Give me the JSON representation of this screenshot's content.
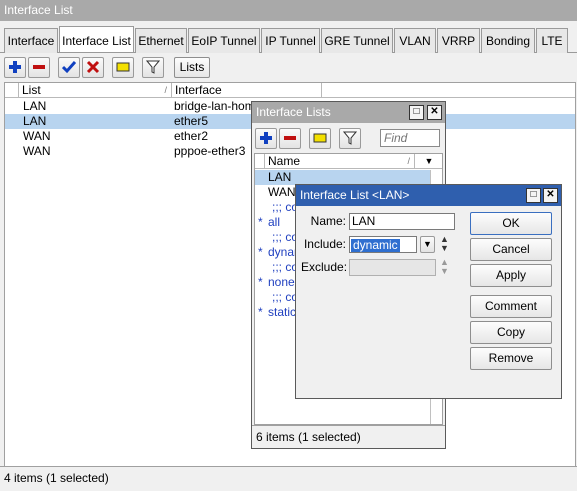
{
  "main": {
    "title": "Interface List",
    "tabs": [
      "Interface",
      "Interface List",
      "Ethernet",
      "EoIP Tunnel",
      "IP Tunnel",
      "GRE Tunnel",
      "VLAN",
      "VRRP",
      "Bonding",
      "LTE"
    ],
    "lists_button": "Lists",
    "columns": [
      "List",
      "Interface"
    ],
    "rows": [
      {
        "list": "LAN",
        "interface": "bridge-lan-home"
      },
      {
        "list": "LAN",
        "interface": "ether5"
      },
      {
        "list": "WAN",
        "interface": "ether2"
      },
      {
        "list": "WAN",
        "interface": "pppoe-ether3"
      }
    ],
    "status": "4 items (1 selected)"
  },
  "lists_window": {
    "title": "Interface Lists",
    "find_placeholder": "Find",
    "column": "Name",
    "rows": [
      {
        "flag": "",
        "name": "LAN"
      },
      {
        "flag": "",
        "name": "WAN"
      },
      {
        "flag": "",
        "name": ";;; co"
      },
      {
        "flag": "*",
        "name": "all"
      },
      {
        "flag": "",
        "name": ";;; co"
      },
      {
        "flag": "*",
        "name": "dynam"
      },
      {
        "flag": "",
        "name": ";;; co"
      },
      {
        "flag": "*",
        "name": "none"
      },
      {
        "flag": "",
        "name": ";;; co"
      },
      {
        "flag": "*",
        "name": "static"
      }
    ],
    "status": "6 items (1 selected)"
  },
  "dialog": {
    "title": "Interface List <LAN>",
    "name_label": "Name:",
    "name_value": "LAN",
    "include_label": "Include:",
    "include_value": "dynamic",
    "exclude_label": "Exclude:",
    "exclude_value": "",
    "buttons": {
      "ok": "OK",
      "cancel": "Cancel",
      "apply": "Apply",
      "comment": "Comment",
      "copy": "Copy",
      "remove": "Remove"
    }
  },
  "colors": {
    "titlebar_active": "#2f5fae",
    "titlebar_inactive": "#a9a9a9",
    "selection": "#b8d4ef",
    "add": "#1040c0",
    "remove": "#c01010"
  }
}
